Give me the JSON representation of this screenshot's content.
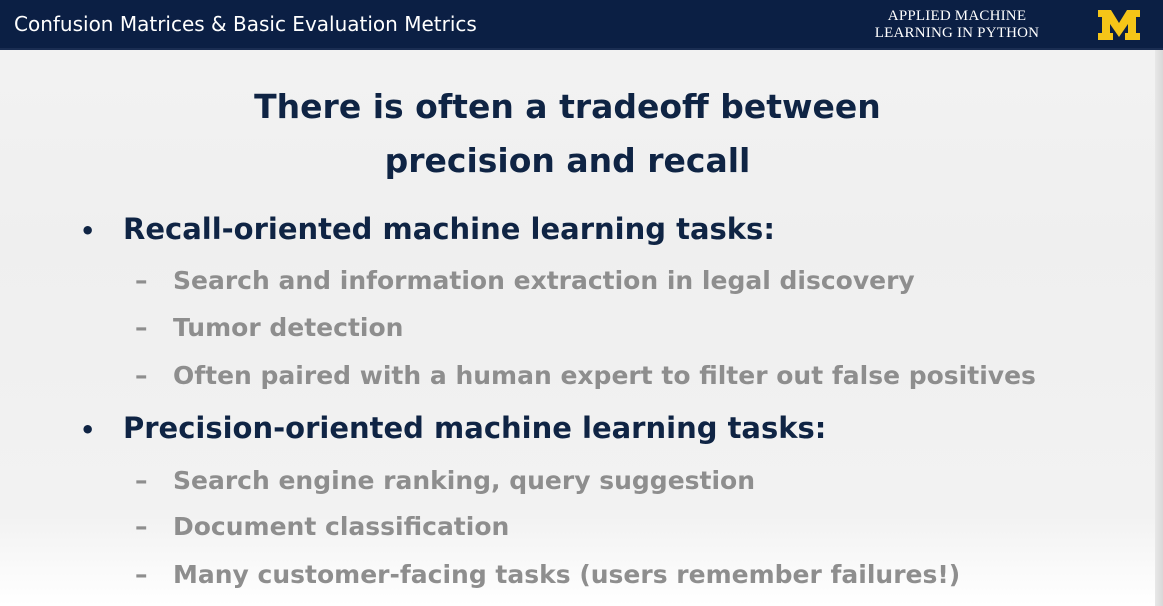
{
  "header": {
    "title": "Confusion Matrices & Basic Evaluation Metrics",
    "course_line1": "APPLIED MACHINE",
    "course_line2": "LEARNING IN PYTHON",
    "logo_letter": "M",
    "logo_icon": "university-of-michigan-block-m-icon"
  },
  "colors": {
    "header_bg": "#0b1f44",
    "logo_maize": "#f5c518",
    "title_text": "#0f2444",
    "sub_text": "#8e8e8e"
  },
  "slide": {
    "title_line1": "There is often a tradeoff between",
    "title_line2": "precision and recall",
    "sections": [
      {
        "heading": "Recall-oriented machine learning tasks:",
        "items": [
          "Search and information extraction in legal discovery",
          "Tumor detection",
          "Often paired with a human expert to filter out false positives"
        ]
      },
      {
        "heading": "Precision-oriented machine learning tasks:",
        "items": [
          "Search engine ranking, query suggestion",
          "Document classification",
          "Many customer-facing tasks (users remember failures!)"
        ]
      }
    ],
    "bullet_symbol": "•",
    "dash_symbol": "–"
  }
}
